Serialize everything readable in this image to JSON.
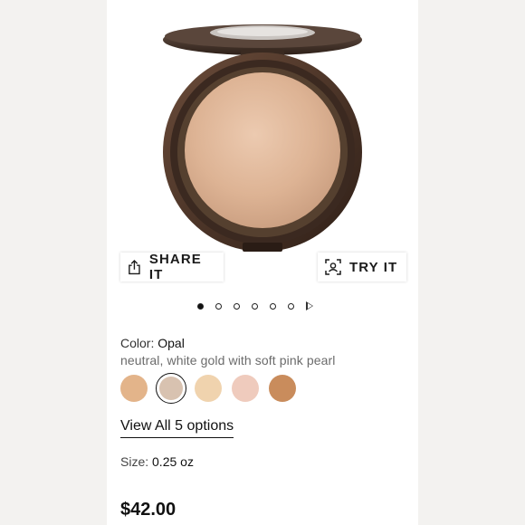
{
  "actions": {
    "share_label": "SHARE IT",
    "try_label": "TRY IT"
  },
  "gallery": {
    "dot_count": 6,
    "active_index": 0
  },
  "product": {
    "color_label": "Color:",
    "color_value": "Opal",
    "color_description": "neutral, white gold with soft pink pearl",
    "swatches": [
      {
        "color": "#e3b48a"
      },
      {
        "color": "#d8c2b0",
        "selected": true
      },
      {
        "color": "#f0d3ae"
      },
      {
        "color": "#efcbbd"
      },
      {
        "color": "#c98c5c"
      }
    ],
    "view_all": "View All 5 options",
    "size_label": "Size:",
    "size_value": "0.25 oz",
    "price": "$42.00"
  },
  "colors": {
    "compact_shell": "#4a3327",
    "powder": "#e0b99a",
    "accent": "#111111"
  }
}
